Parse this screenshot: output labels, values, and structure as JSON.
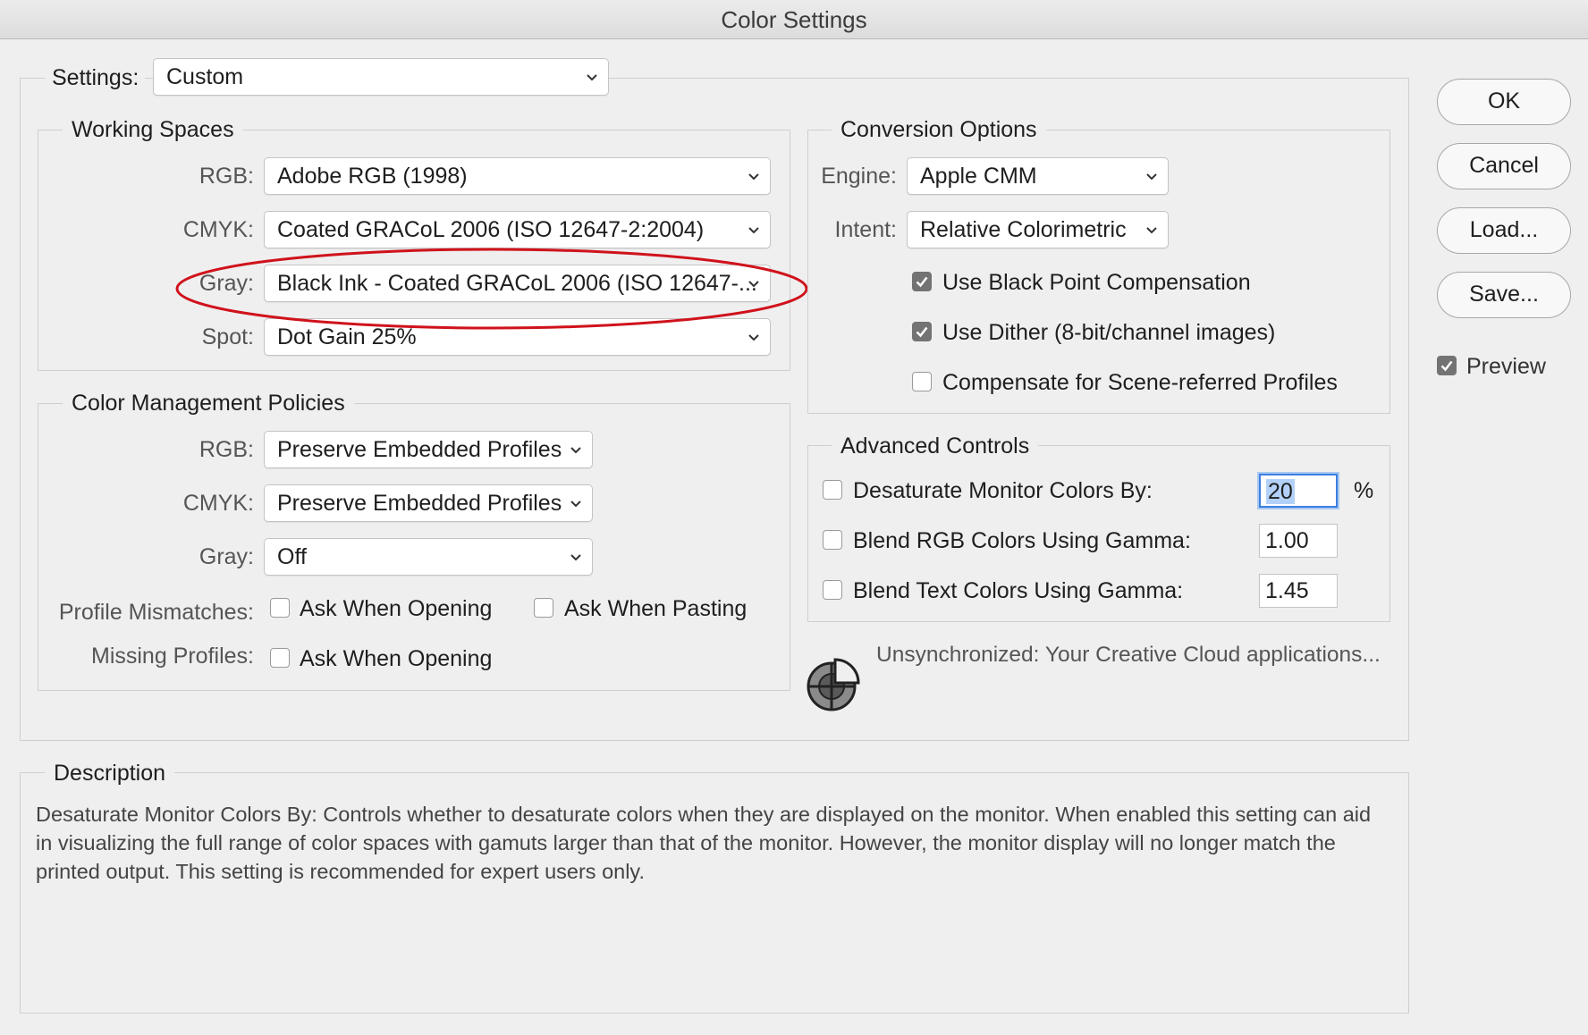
{
  "window": {
    "title": "Color Settings"
  },
  "settings": {
    "label": "Settings:",
    "value": "Custom"
  },
  "working_spaces": {
    "title": "Working Spaces",
    "rgb": {
      "label": "RGB:",
      "value": "Adobe RGB (1998)"
    },
    "cmyk": {
      "label": "CMYK:",
      "value": "Coated GRACoL 2006 (ISO 12647-2:2004)"
    },
    "gray": {
      "label": "Gray:",
      "value": "Black Ink - Coated GRACoL 2006 (ISO 12647-..."
    },
    "spot": {
      "label": "Spot:",
      "value": "Dot Gain 25%"
    }
  },
  "policies": {
    "title": "Color Management Policies",
    "rgb": {
      "label": "RGB:",
      "value": "Preserve Embedded Profiles"
    },
    "cmyk": {
      "label": "CMYK:",
      "value": "Preserve Embedded Profiles"
    },
    "gray": {
      "label": "Gray:",
      "value": "Off"
    },
    "mismatches": {
      "label": "Profile Mismatches:",
      "ask_opening": "Ask When Opening",
      "ask_pasting": "Ask When Pasting",
      "ask_opening_checked": false,
      "ask_pasting_checked": false
    },
    "missing": {
      "label": "Missing Profiles:",
      "ask_opening": "Ask When Opening",
      "ask_opening_checked": false
    }
  },
  "conversion": {
    "title": "Conversion Options",
    "engine": {
      "label": "Engine:",
      "value": "Apple CMM"
    },
    "intent": {
      "label": "Intent:",
      "value": "Relative Colorimetric"
    },
    "black_point": {
      "label": "Use Black Point Compensation",
      "checked": true
    },
    "dither": {
      "label": "Use Dither (8-bit/channel images)",
      "checked": true
    },
    "scene_referred": {
      "label": "Compensate for Scene-referred Profiles",
      "checked": false
    }
  },
  "advanced": {
    "title": "Advanced Controls",
    "desaturate": {
      "label": "Desaturate Monitor Colors By:",
      "value": "20",
      "unit": "%",
      "checked": false
    },
    "blend_rgb": {
      "label": "Blend RGB Colors Using Gamma:",
      "value": "1.00",
      "checked": false
    },
    "blend_text": {
      "label": "Blend Text Colors Using Gamma:",
      "value": "1.45",
      "checked": false
    }
  },
  "sync": {
    "status": "Unsynchronized: Your Creative Cloud applications...",
    "icon": "sync-status-icon"
  },
  "description": {
    "title": "Description",
    "text": "Desaturate Monitor Colors By:  Controls whether to desaturate colors when they are displayed on the monitor.  When enabled this setting can aid in visualizing the full range of color spaces with gamuts larger than that of the monitor.  However, the monitor display will no longer match the printed output.  This setting is recommended for expert users only."
  },
  "buttons": {
    "ok": "OK",
    "cancel": "Cancel",
    "load": "Load...",
    "save": "Save..."
  },
  "preview": {
    "label": "Preview",
    "checked": true
  },
  "colors": {
    "highlight_ellipse": "#d0121b",
    "focus_ring": "#3d7fe0",
    "checkbox_on": "#737373"
  }
}
